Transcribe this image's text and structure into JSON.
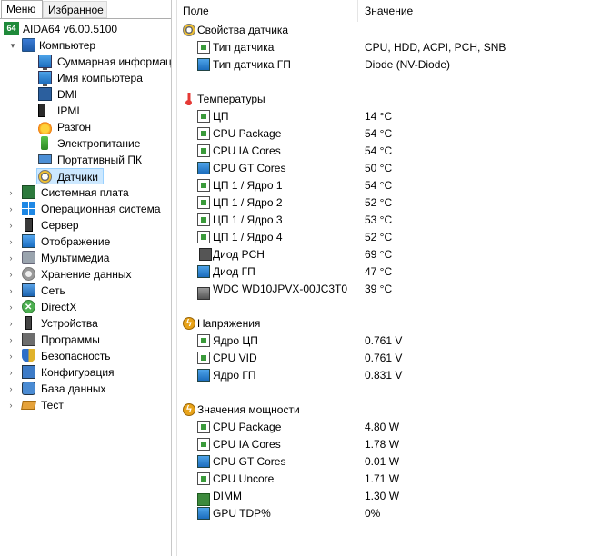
{
  "tabs": {
    "menu": "Меню",
    "favorites": "Избранное"
  },
  "tree": {
    "root": {
      "label": "AIDA64 v6.00.5100",
      "icon": "aida64-logo-icon",
      "badge": "64"
    },
    "computer": {
      "label": "Компьютер",
      "children": [
        {
          "label": "Суммарная информация",
          "icon": "summary-icon"
        },
        {
          "label": "Имя компьютера",
          "icon": "computer-name-icon"
        },
        {
          "label": "DMI",
          "icon": "dmi-icon"
        },
        {
          "label": "IPMI",
          "icon": "ipmi-icon"
        },
        {
          "label": "Разгон",
          "icon": "overclock-flame-icon"
        },
        {
          "label": "Электропитание",
          "icon": "battery-icon"
        },
        {
          "label": "Портативный ПК",
          "icon": "laptop-icon"
        },
        {
          "label": "Датчики",
          "icon": "sensor-gauge-icon",
          "selected": true
        }
      ]
    },
    "sections": [
      {
        "label": "Системная плата",
        "icon": "motherboard-icon"
      },
      {
        "label": "Операционная система",
        "icon": "windows-icon"
      },
      {
        "label": "Сервер",
        "icon": "server-icon"
      },
      {
        "label": "Отображение",
        "icon": "display-icon"
      },
      {
        "label": "Мультимедиа",
        "icon": "multimedia-icon"
      },
      {
        "label": "Хранение данных",
        "icon": "storage-icon"
      },
      {
        "label": "Сеть",
        "icon": "network-icon"
      },
      {
        "label": "DirectX",
        "icon": "directx-icon"
      },
      {
        "label": "Устройства",
        "icon": "devices-icon"
      },
      {
        "label": "Программы",
        "icon": "programs-icon"
      },
      {
        "label": "Безопасность",
        "icon": "security-shield-icon"
      },
      {
        "label": "Конфигурация",
        "icon": "config-icon"
      },
      {
        "label": "База данных",
        "icon": "database-icon"
      },
      {
        "label": "Тест",
        "icon": "benchmark-icon"
      }
    ]
  },
  "columns": {
    "field": "Поле",
    "value": "Значение"
  },
  "groups": [
    {
      "title": "Свойства датчика",
      "icon": "sensor-gauge-icon",
      "rows": [
        {
          "field": "Тип датчика",
          "value": "CPU, HDD, ACPI, PCH, SNB",
          "icon": "chip-icon"
        },
        {
          "field": "Тип датчика ГП",
          "value": "Diode  (NV-Diode)",
          "icon": "gpu-icon"
        }
      ]
    },
    {
      "title": "Температуры",
      "icon": "thermometer-icon",
      "rows": [
        {
          "field": "ЦП",
          "value": "14 °C",
          "icon": "chip-icon"
        },
        {
          "field": "CPU Package",
          "value": "54 °C",
          "icon": "chip-icon"
        },
        {
          "field": "CPU IA Cores",
          "value": "54 °C",
          "icon": "chip-icon"
        },
        {
          "field": "CPU GT Cores",
          "value": "50 °C",
          "icon": "gpu-icon"
        },
        {
          "field": "ЦП 1 / Ядро 1",
          "value": "54 °C",
          "icon": "chip-icon"
        },
        {
          "field": "ЦП 1 / Ядро 2",
          "value": "52 °C",
          "icon": "chip-icon"
        },
        {
          "field": "ЦП 1 / Ядро 3",
          "value": "53 °C",
          "icon": "chip-icon"
        },
        {
          "field": "ЦП 1 / Ядро 4",
          "value": "52 °C",
          "icon": "chip-icon"
        },
        {
          "field": "Диод PCH",
          "value": "69 °C",
          "icon": "diode-icon"
        },
        {
          "field": "Диод ГП",
          "value": "47 °C",
          "icon": "gpu-icon"
        },
        {
          "field": "WDC WD10JPVX-00JC3T0",
          "value": "39 °C",
          "icon": "hdd-icon"
        }
      ]
    },
    {
      "title": "Напряжения",
      "icon": "voltage-icon",
      "rows": [
        {
          "field": "Ядро ЦП",
          "value": "0.761 V",
          "icon": "chip-icon"
        },
        {
          "field": "CPU VID",
          "value": "0.761 V",
          "icon": "chip-icon"
        },
        {
          "field": "Ядро ГП",
          "value": "0.831 V",
          "icon": "gpu-icon"
        }
      ]
    },
    {
      "title": "Значения мощности",
      "icon": "power-icon",
      "rows": [
        {
          "field": "CPU Package",
          "value": "4.80 W",
          "icon": "chip-icon"
        },
        {
          "field": "CPU IA Cores",
          "value": "1.78 W",
          "icon": "chip-icon"
        },
        {
          "field": "CPU GT Cores",
          "value": "0.01 W",
          "icon": "gpu-icon"
        },
        {
          "field": "CPU Uncore",
          "value": "1.71 W",
          "icon": "chip-icon"
        },
        {
          "field": "DIMM",
          "value": "1.30 W",
          "icon": "dimm-icon"
        },
        {
          "field": "GPU TDP%",
          "value": "0%",
          "icon": "gpu-icon"
        }
      ]
    }
  ]
}
